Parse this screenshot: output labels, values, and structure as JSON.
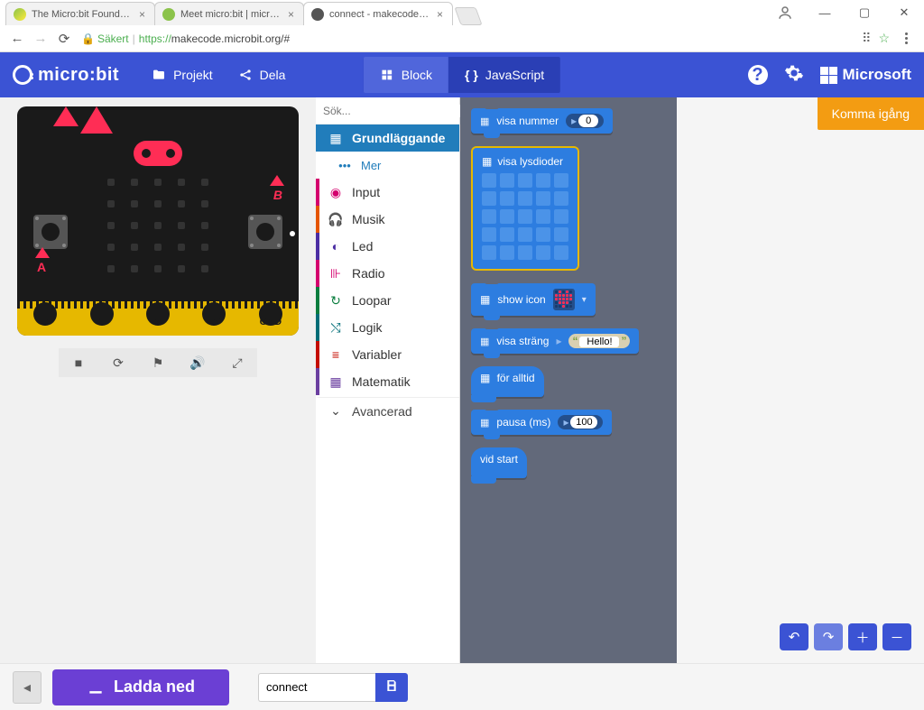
{
  "browser": {
    "tabs": [
      {
        "title": "The Micro:bit Foundation",
        "active": false
      },
      {
        "title": "Meet micro:bit | micro:bit",
        "active": false
      },
      {
        "title": "connect - makecode.mic",
        "active": true
      }
    ],
    "secure_label": "Säkert",
    "url_protocol": "https://",
    "url_rest": "makecode.microbit.org/#"
  },
  "appbar": {
    "logo": "micro:bit",
    "projekt": "Projekt",
    "dela": "Dela",
    "block": "Block",
    "javascript": "JavaScript",
    "microsoft": "Microsoft"
  },
  "toolbox": {
    "search_placeholder": "Sök...",
    "cats": [
      {
        "id": "basic",
        "label": "Grundläggande",
        "icon": "⬚"
      },
      {
        "id": "more",
        "label": "Mer",
        "icon": "•••"
      },
      {
        "id": "input",
        "label": "Input",
        "icon": "◉"
      },
      {
        "id": "music",
        "label": "Musik",
        "icon": "♫"
      },
      {
        "id": "led",
        "label": "Led",
        "icon": "◐"
      },
      {
        "id": "radio",
        "label": "Radio",
        "icon": "⊪"
      },
      {
        "id": "loops",
        "label": "Loopar",
        "icon": "↻"
      },
      {
        "id": "logic",
        "label": "Logik",
        "icon": "⤭"
      },
      {
        "id": "variables",
        "label": "Variabler",
        "icon": "≡"
      },
      {
        "id": "math",
        "label": "Matematik",
        "icon": "▦"
      }
    ],
    "advanced": "Avancerad"
  },
  "blocks": {
    "show_number": "visa nummer",
    "show_number_val": "0",
    "show_leds": "visa lysdioder",
    "show_icon": "show icon",
    "show_string": "visa sträng",
    "show_string_val": "Hello!",
    "forever": "för alltid",
    "pause": "pausa (ms)",
    "pause_val": "100",
    "on_start": "vid start"
  },
  "board": {
    "pins": [
      "0",
      "1",
      "2",
      "3V",
      "GND"
    ]
  },
  "workspace": {
    "getting_started": "Komma igång"
  },
  "bottom": {
    "download": "Ladda ned",
    "project_name": "connect"
  }
}
